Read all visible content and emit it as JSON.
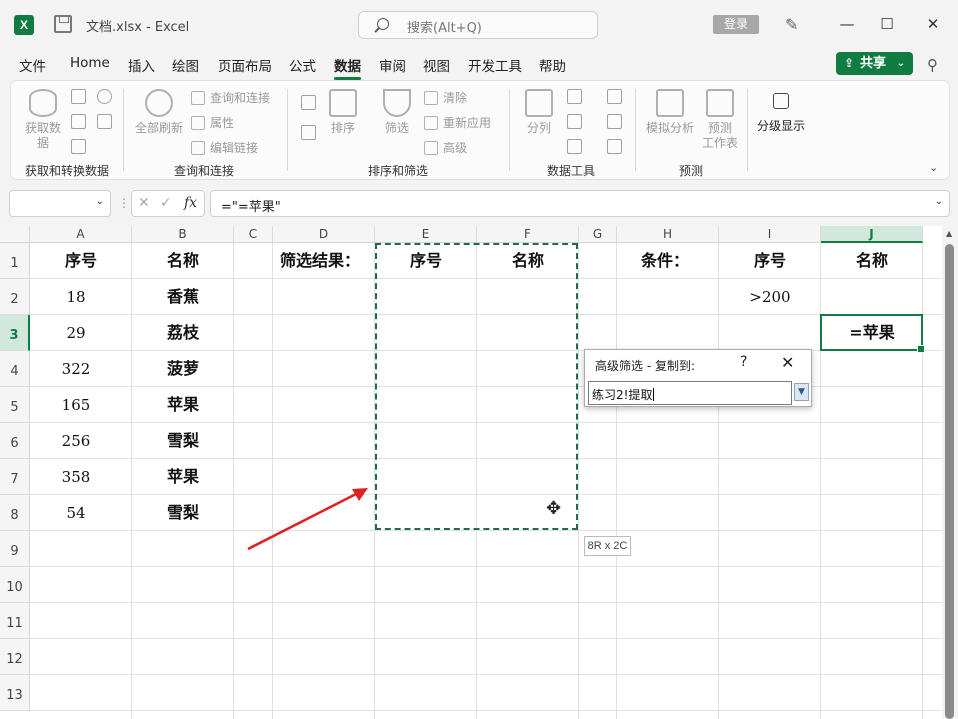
{
  "titlebar": {
    "doc_title": "文档.xlsx  -  Excel",
    "search_placeholder": "搜索(Alt+Q)",
    "login_label": "登录",
    "minimize": "—",
    "maximize": "☐",
    "close": "✕"
  },
  "menu": {
    "items": [
      "文件",
      "Home",
      "插入",
      "绘图",
      "页面布局",
      "公式",
      "数据",
      "审阅",
      "视图",
      "开发工具",
      "帮助"
    ],
    "active": "数据",
    "share_label": "共享"
  },
  "ribbon": {
    "groups": [
      {
        "label": "获取和转换数据",
        "big": "获取数\n据"
      },
      {
        "label": "查询和连接",
        "big": "全部刷新",
        "small": [
          "查询和连接",
          "属性",
          "编辑链接"
        ]
      },
      {
        "label": "排序和筛选",
        "big": [
          "排序",
          "筛选"
        ],
        "small": [
          "清除",
          "重新应用",
          "高级"
        ]
      },
      {
        "label": "数据工具",
        "big": "分列"
      },
      {
        "label": "预测",
        "big": [
          "模拟分析",
          "预测\n工作表"
        ]
      },
      {
        "label": "",
        "big": "分级显示"
      }
    ]
  },
  "formula_bar": {
    "name_box": "",
    "formula": "=\"=苹果\""
  },
  "grid": {
    "columns": [
      "A",
      "B",
      "C",
      "D",
      "E",
      "F",
      "G",
      "H",
      "I",
      "J"
    ],
    "selected_column": "J",
    "rows": [
      "1",
      "2",
      "3",
      "4",
      "5",
      "6",
      "7",
      "8",
      "9",
      "10",
      "11",
      "12",
      "13"
    ],
    "selected_row": "3",
    "cells": {
      "A1": "序号",
      "B1": "名称",
      "D1": "筛选结果：",
      "E1": "序号",
      "F1": "名称",
      "H1": "条件：",
      "I1": "序号",
      "J1": "名称",
      "A2": "18",
      "B2": "香蕉",
      "I2": ">200",
      "A3": "29",
      "B3": "荔枝",
      "J3": "=苹果",
      "A4": "322",
      "B4": "菠萝",
      "A5": "165",
      "B5": "苹果",
      "A6": "256",
      "B6": "雪梨",
      "A7": "358",
      "B7": "苹果",
      "A8": "54",
      "B8": "雪梨"
    },
    "size_tip": "8R x 2C"
  },
  "dialog": {
    "title": "高级筛选 - 复制到:",
    "help": "?",
    "close": "✕",
    "input_value": "练习2!提取"
  },
  "colors": {
    "accent": "#107c41",
    "arrow": "#e02020"
  }
}
